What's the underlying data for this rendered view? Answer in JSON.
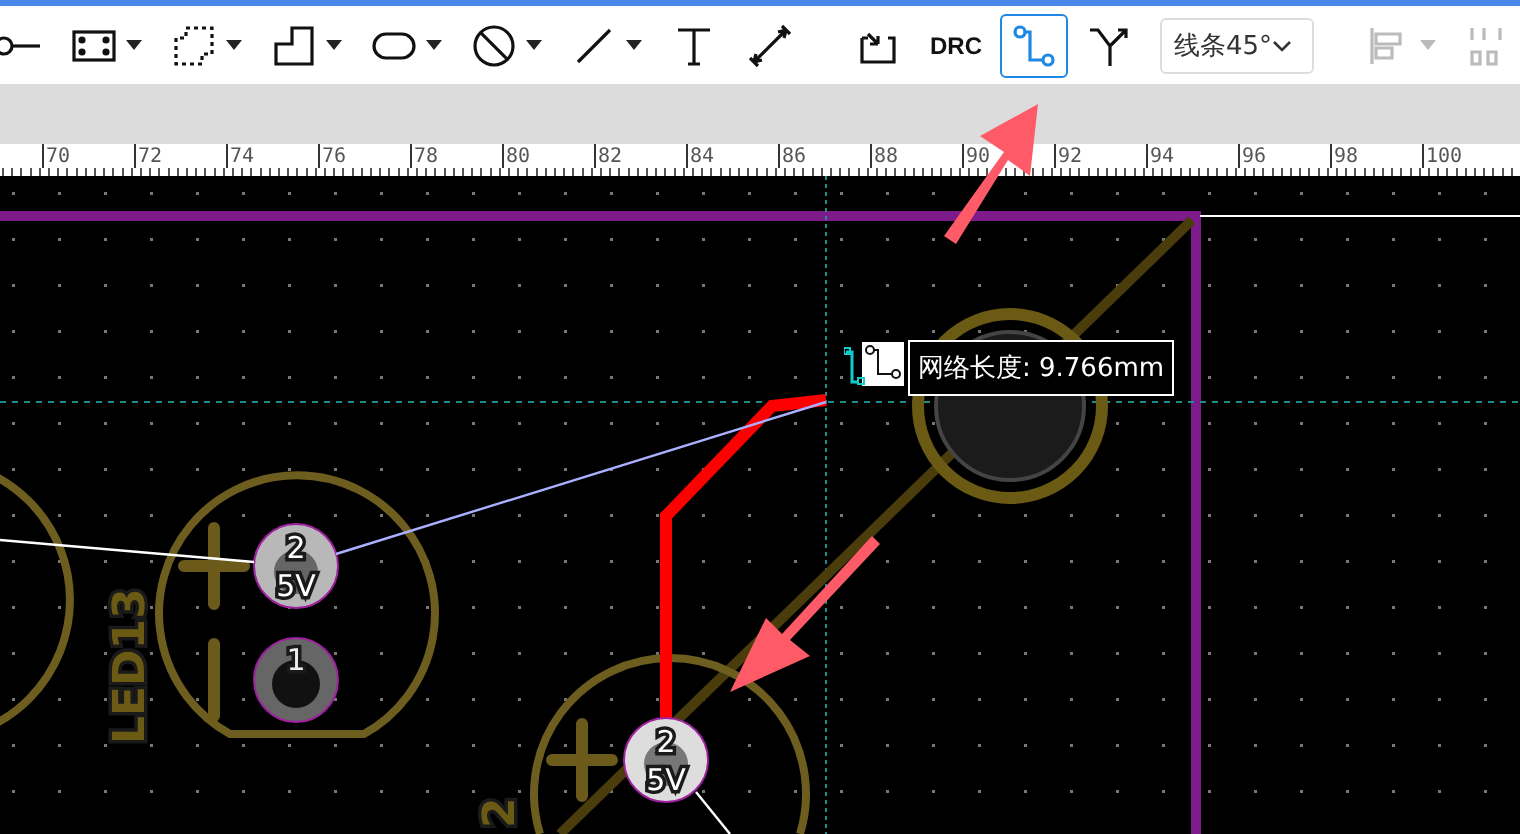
{
  "toolbar": {
    "tools": [
      {
        "kind": "pin",
        "dropdown": false,
        "selected": false,
        "disabled": false
      },
      {
        "kind": "pad",
        "dropdown": true,
        "selected": false,
        "disabled": false
      },
      {
        "kind": "area",
        "dropdown": true,
        "selected": false,
        "disabled": false
      },
      {
        "kind": "polygon",
        "dropdown": true,
        "selected": false,
        "disabled": false
      },
      {
        "kind": "ellipse",
        "dropdown": true,
        "selected": false,
        "disabled": false
      },
      {
        "kind": "nosign",
        "dropdown": true,
        "selected": false,
        "disabled": false
      },
      {
        "kind": "line",
        "dropdown": true,
        "selected": false,
        "disabled": false
      },
      {
        "kind": "text",
        "dropdown": false,
        "selected": false,
        "disabled": false
      },
      {
        "kind": "dimension",
        "dropdown": false,
        "selected": false,
        "disabled": false
      },
      {
        "kind": "divider"
      },
      {
        "kind": "import",
        "dropdown": false,
        "selected": false,
        "disabled": false
      },
      {
        "kind": "label",
        "label": "DRC",
        "dropdown": false,
        "selected": false,
        "disabled": false
      },
      {
        "kind": "route",
        "dropdown": false,
        "selected": true,
        "disabled": false
      },
      {
        "kind": "diffpair",
        "dropdown": false,
        "selected": false,
        "disabled": false
      },
      {
        "kind": "select",
        "value": "线条45°"
      },
      {
        "kind": "divider"
      },
      {
        "kind": "align",
        "dropdown": true,
        "selected": false,
        "disabled": true
      },
      {
        "kind": "distribute",
        "dropdown": false,
        "selected": false,
        "disabled": true
      }
    ]
  },
  "ruler": {
    "labels": [
      "70",
      "72",
      "74",
      "76",
      "78",
      "80",
      "82",
      "84",
      "86",
      "88",
      "90",
      "92",
      "94",
      "96",
      "98",
      "100"
    ]
  },
  "canvas": {
    "components": [
      {
        "designator": "LED13",
        "pads": [
          {
            "number": "2",
            "net": "5V"
          },
          {
            "number": "1"
          }
        ]
      },
      {
        "designator": "2",
        "pads": [
          {
            "number": "2",
            "net": "5V"
          }
        ]
      }
    ],
    "tooltip": {
      "text": "网络长度: 9.766mm"
    }
  }
}
